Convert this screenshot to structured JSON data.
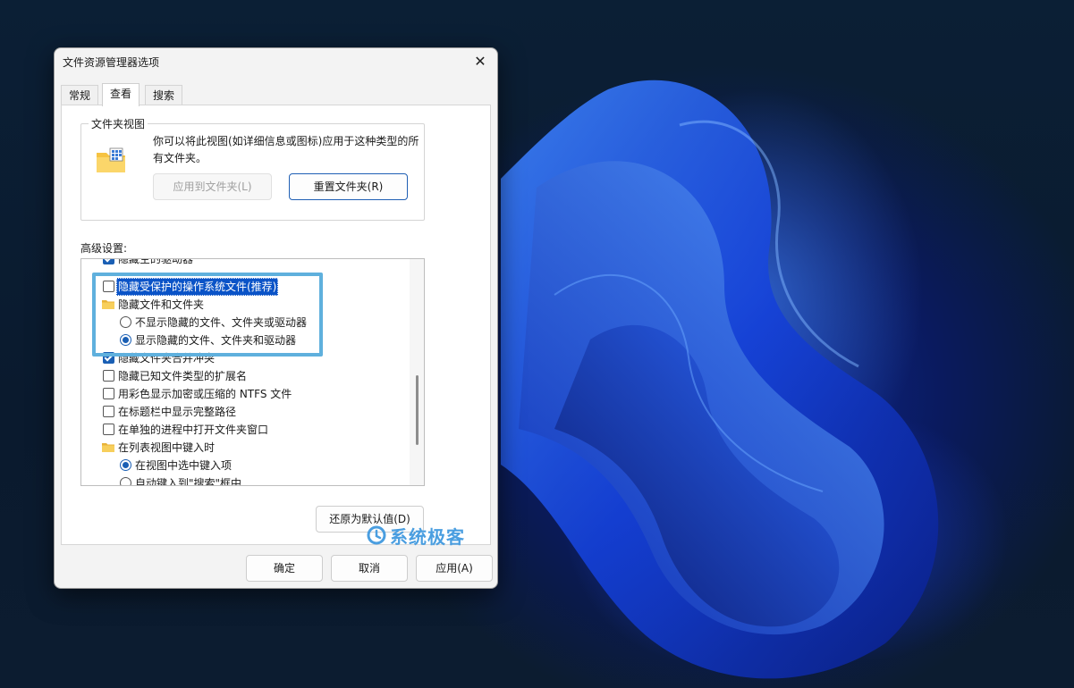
{
  "dialog": {
    "title": "文件资源管理器选项",
    "close_icon": "close-icon",
    "tabs": [
      {
        "label": "常规",
        "active": false
      },
      {
        "label": "查看",
        "active": true
      },
      {
        "label": "搜索",
        "active": false
      }
    ],
    "folder_views": {
      "group_label": "文件夹视图",
      "icon": "folder-view-icon",
      "description": "你可以将此视图(如详细信息或图标)应用于这种类型的所有文件夹。",
      "apply_button": "应用到文件夹(L)",
      "reset_button": "重置文件夹(R)"
    },
    "advanced": {
      "label": "高级设置:",
      "items": [
        {
          "type": "checkbox",
          "checked": true,
          "label": "隐藏空的驱动器"
        },
        {
          "type": "checkbox",
          "checked": false,
          "label": "隐藏受保护的操作系统文件(推荐)",
          "selected": true
        },
        {
          "type": "folder",
          "label": "隐藏文件和文件夹"
        },
        {
          "type": "radio",
          "checked": false,
          "label": "不显示隐藏的文件、文件夹或驱动器"
        },
        {
          "type": "radio",
          "checked": true,
          "label": "显示隐藏的文件、文件夹和驱动器"
        },
        {
          "type": "checkbox",
          "checked": true,
          "label": "隐藏文件夹合并冲突"
        },
        {
          "type": "checkbox",
          "checked": false,
          "label": "隐藏已知文件类型的扩展名"
        },
        {
          "type": "checkbox",
          "checked": false,
          "label": "用彩色显示加密或压缩的 NTFS 文件"
        },
        {
          "type": "checkbox",
          "checked": false,
          "label": "在标题栏中显示完整路径"
        },
        {
          "type": "checkbox",
          "checked": false,
          "label": "在单独的进程中打开文件夹窗口"
        },
        {
          "type": "folder",
          "label": "在列表视图中键入时"
        },
        {
          "type": "radio",
          "checked": true,
          "label": "在视图中选中键入项"
        },
        {
          "type": "radio",
          "checked": false,
          "label": "自动键入到\"搜索\"框中"
        }
      ]
    },
    "restore_button": "还原为默认值(D)",
    "ok_button": "确定",
    "cancel_button": "取消",
    "apply_button": "应用(A)"
  },
  "watermark": {
    "text": "系统极客",
    "color": "#4a9ee0"
  },
  "colors": {
    "accent": "#1a5fb4",
    "highlight_border": "#5fb0dd",
    "selection": "#0a53c7"
  }
}
